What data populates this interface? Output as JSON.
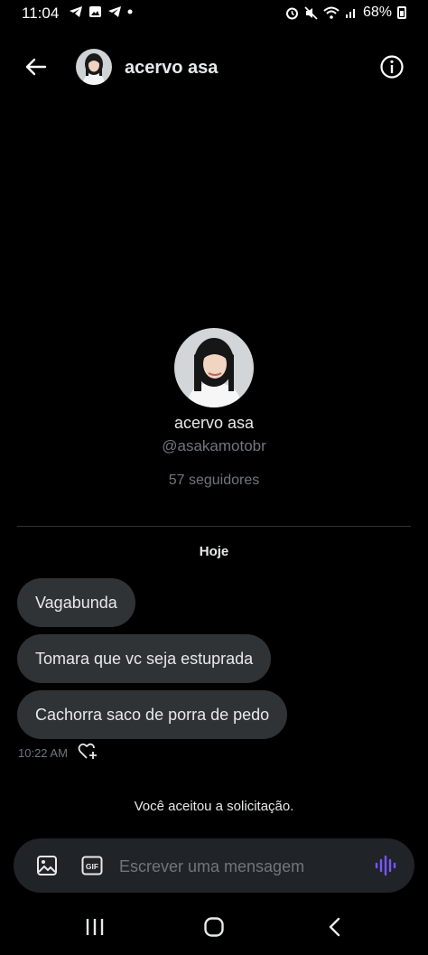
{
  "status_bar": {
    "time": "11:04",
    "battery": "68%"
  },
  "header": {
    "title": "acervo asa"
  },
  "profile": {
    "name": "acervo asa",
    "handle": "@asakamotobr",
    "followers": "57 seguidores"
  },
  "date_label": "Hoje",
  "messages": [
    {
      "text": "Vagabunda"
    },
    {
      "text": "Tomara que vc seja estuprada"
    },
    {
      "text": "Cachorra saco de porra de pedo"
    }
  ],
  "message_time": "10:22 AM",
  "system_message": "Você aceitou a solicitação.",
  "composer": {
    "placeholder": "Escrever uma mensagem"
  },
  "colors": {
    "background": "#000000",
    "bubble": "#2f3336",
    "secondary_text": "#71767b",
    "accent_voice": "#7856ff"
  },
  "icons": [
    "back-arrow-icon",
    "info-icon",
    "heart-plus-icon",
    "image-icon",
    "gif-icon",
    "voice-wave-icon",
    "recents-icon",
    "home-icon",
    "nav-back-icon"
  ]
}
